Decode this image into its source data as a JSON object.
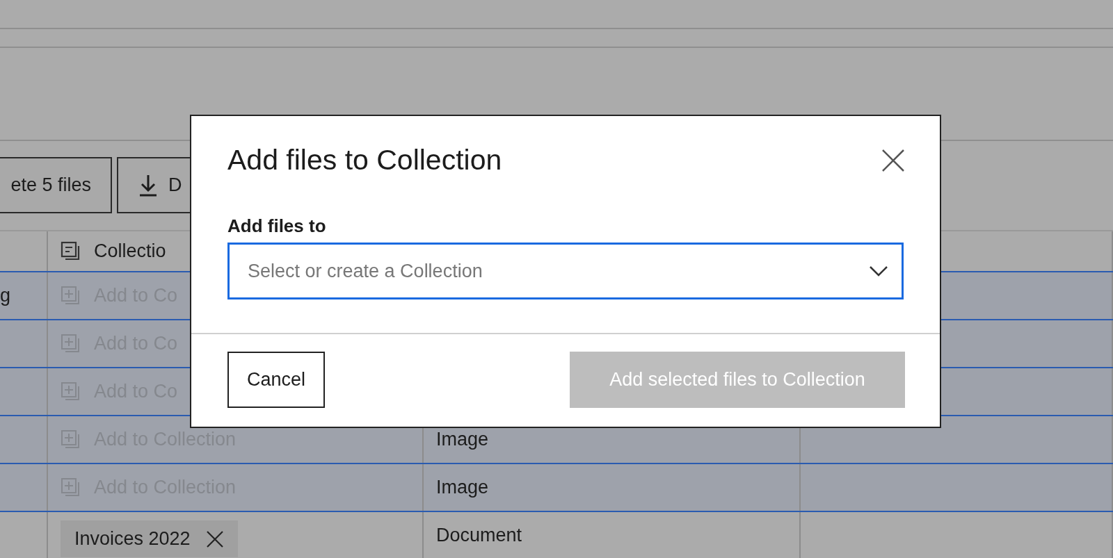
{
  "toolbar": {
    "buttons": [
      {
        "label": "ete 5 files",
        "kind": "text"
      },
      {
        "label": "D",
        "kind": "download"
      }
    ]
  },
  "table": {
    "columns": [
      {
        "label": "Collectio",
        "kind": "collection"
      }
    ],
    "rows": [
      {
        "selected": true,
        "name": "g",
        "collection": {
          "kind": "add",
          "label": "Add to Co"
        }
      },
      {
        "selected": true,
        "collection": {
          "kind": "add",
          "label": "Add to Co"
        }
      },
      {
        "selected": true,
        "collection": {
          "kind": "add",
          "label": "Add to Co"
        }
      },
      {
        "selected": true,
        "collection": {
          "kind": "add",
          "label": "Add to Collection"
        },
        "type": "Image"
      },
      {
        "selected": true,
        "collection": {
          "kind": "add",
          "label": "Add to Collection"
        },
        "type": "Image"
      },
      {
        "selected": false,
        "collection": {
          "kind": "tag",
          "label": "Invoices 2022"
        },
        "type": "Document"
      }
    ]
  },
  "dialog": {
    "title": "Add files to Collection",
    "field": {
      "label": "Add files to",
      "placeholder": "Select or create a Collection",
      "focused": true
    },
    "buttons": [
      {
        "label": "Cancel",
        "kind": "secondary",
        "disabled": false
      },
      {
        "label": "Add selected files to Collection",
        "kind": "primary",
        "disabled": true
      }
    ]
  }
}
